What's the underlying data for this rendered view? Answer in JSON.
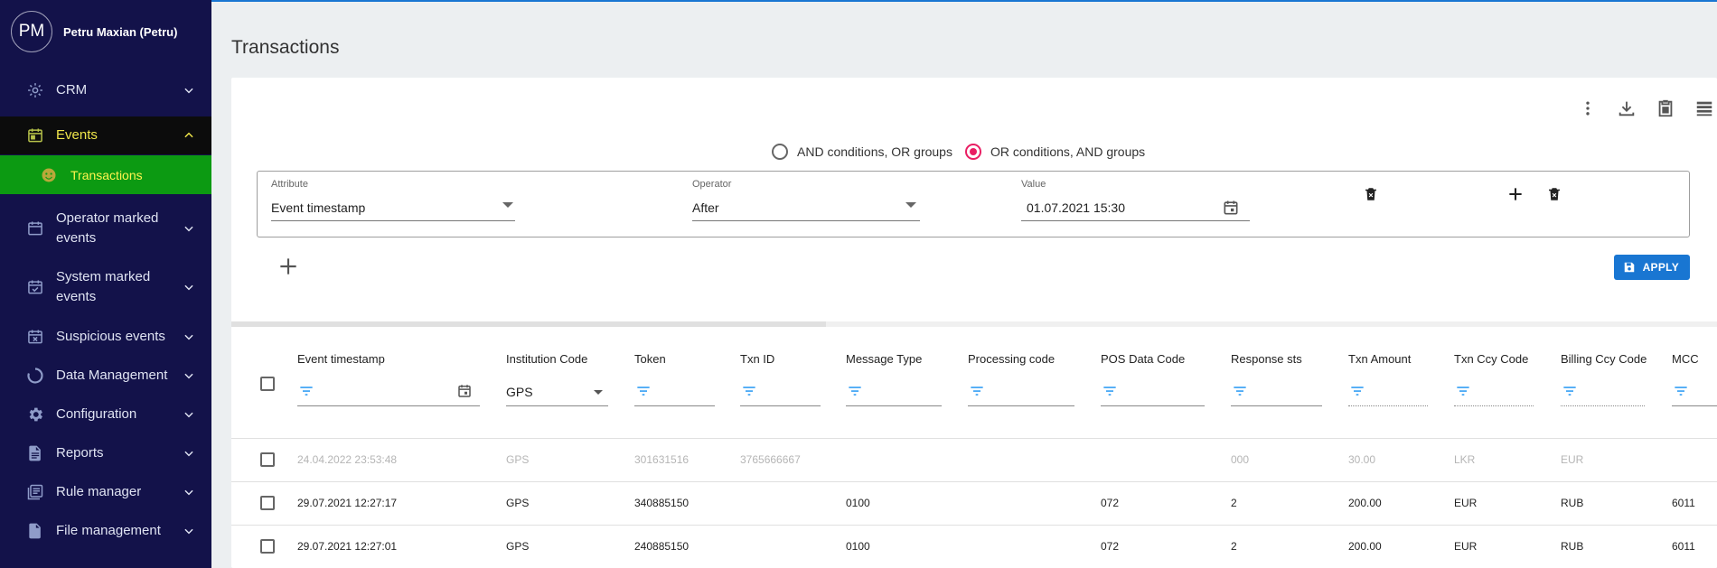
{
  "user": {
    "initials": "PM",
    "name": "Petru Maxian (Petru)"
  },
  "sidebar": {
    "items": [
      {
        "label": "CRM",
        "icon": "gear-icon"
      },
      {
        "label": "Events",
        "icon": "calendar-icon"
      },
      {
        "label": "Transactions",
        "icon": "face-icon"
      },
      {
        "label": "Operator marked events",
        "icon": "calendar-icon"
      },
      {
        "label": "System marked events",
        "icon": "calendar-check-icon"
      },
      {
        "label": "Suspicious events",
        "icon": "calendar-x-icon"
      },
      {
        "label": "Data Management",
        "icon": "donut-icon"
      },
      {
        "label": "Configuration",
        "icon": "gear-icon"
      },
      {
        "label": "Reports",
        "icon": "document-icon"
      },
      {
        "label": "Rule manager",
        "icon": "list-icon"
      },
      {
        "label": "File management",
        "icon": "file-icon"
      }
    ]
  },
  "page": {
    "title": "Transactions"
  },
  "filter": {
    "logic_options": [
      "AND conditions, OR groups",
      "OR conditions, AND groups"
    ],
    "selected_logic": 1,
    "attribute_label": "Attribute",
    "attribute_value": "Event timestamp",
    "operator_label": "Operator",
    "operator_value": "After",
    "value_label": "Value",
    "value_value": "01.07.2021 15:30",
    "apply_label": "APPLY",
    "progress": 0.4
  },
  "table": {
    "columns": [
      "Event timestamp",
      "Institution Code",
      "Token",
      "Txn ID",
      "Message Type",
      "Processing code",
      "POS Data Code",
      "Response sts",
      "Txn Amount",
      "Txn Ccy Code",
      "Billing Ccy Code",
      "MCC"
    ],
    "institution_filter": "GPS",
    "rows": [
      {
        "faded": true,
        "cells": [
          "24.04.2022 23:53:48",
          "GPS",
          "301631516",
          "3765666667",
          "",
          "",
          "",
          "000",
          "30.00",
          "LKR",
          "EUR",
          ""
        ]
      },
      {
        "faded": false,
        "cells": [
          "29.07.2021 12:27:17",
          "GPS",
          "340885150",
          "",
          "0100",
          "",
          "072",
          "2",
          "200.00",
          "EUR",
          "RUB",
          "6011"
        ]
      },
      {
        "faded": false,
        "cells": [
          "29.07.2021 12:27:01",
          "GPS",
          "240885150",
          "",
          "0100",
          "",
          "072",
          "2",
          "200.00",
          "EUR",
          "RUB",
          "6011"
        ]
      }
    ]
  }
}
